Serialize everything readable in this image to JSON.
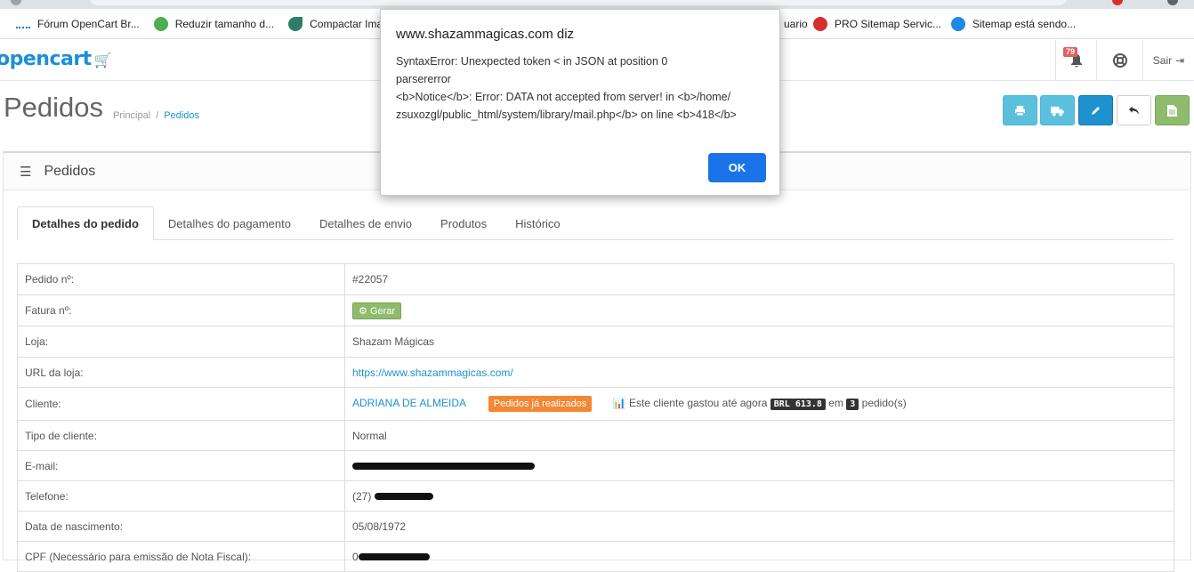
{
  "bookmarks": [
    {
      "label": "Fórum OpenCart Br...",
      "color": "#1a73e8"
    },
    {
      "label": "Reduzir tamanho d...",
      "color": "#4caf50"
    },
    {
      "label": "Compactar Imag",
      "color": "#2e7d6b"
    },
    {
      "label": "uario",
      "color": ""
    },
    {
      "label": "PRO Sitemap Servic...",
      "color": "#d32f2f"
    },
    {
      "label": "Sitemap está sendo...",
      "color": "#1e88e5"
    }
  ],
  "header": {
    "logo": "opencart",
    "notifications_count": "79",
    "logout_label": "Sair"
  },
  "page": {
    "title": "Pedidos",
    "breadcrumb": [
      "Principal",
      "Pedidos"
    ]
  },
  "actions": [
    {
      "name": "print-invoice-button",
      "icon": "print-icon",
      "color": "#5bc0de"
    },
    {
      "name": "print-shipping-button",
      "icon": "truck-icon",
      "color": "#5bc0de"
    },
    {
      "name": "edit-button",
      "icon": "pencil-icon",
      "color": "#1e91cf"
    },
    {
      "name": "back-button",
      "icon": "reply-icon",
      "color": "#ffffff"
    },
    {
      "name": "export-button",
      "icon": "file-icon",
      "color": "#8fbb6c"
    }
  ],
  "panel": {
    "title": "Pedidos",
    "tabs": [
      "Detalhes do pedido",
      "Detalhes do pagamento",
      "Detalhes de envio",
      "Produtos",
      "Histórico"
    ]
  },
  "details": {
    "order_label": "Pedido nº:",
    "order_value": "#22057",
    "invoice_label": "Fatura nº:",
    "invoice_button": "Gerar",
    "store_label": "Loja:",
    "store_value": "Shazam Mágicas",
    "url_label": "URL da loja:",
    "url_value": "https://www.shazammagicas.com/",
    "customer_label": "Cliente:",
    "customer_name": "ADRIANA DE ALMEIDA",
    "customer_orders_button": "Pedidos já realizados",
    "spent_text": "Este cliente gastou até agora",
    "spent_amount": "BRL 613.8",
    "spent_in": "em",
    "order_count": "3",
    "order_count_suffix": "pedido(s)",
    "customer_type_label": "Tipo de cliente:",
    "customer_type_value": "Normal",
    "email_label": "E-mail:",
    "phone_label": "Telefone:",
    "phone_prefix": "(27)",
    "birth_label": "Data de nascimento:",
    "birth_value": "05/08/1972",
    "cpf_label": "CPF (Necessário para emissão de Nota Fiscal):",
    "cpf_prefix": "0"
  },
  "dialog": {
    "title": "www.shazammagicas.com diz",
    "message": "SyntaxError: Unexpected token < in JSON at position 0\nparsererror\n<b>Notice</b>: Error: DATA not accepted from server! in <b>/home/\nzsuxozgl/public_html/system/library/mail.php</b> on line <b>418</b>",
    "ok_label": "OK"
  }
}
